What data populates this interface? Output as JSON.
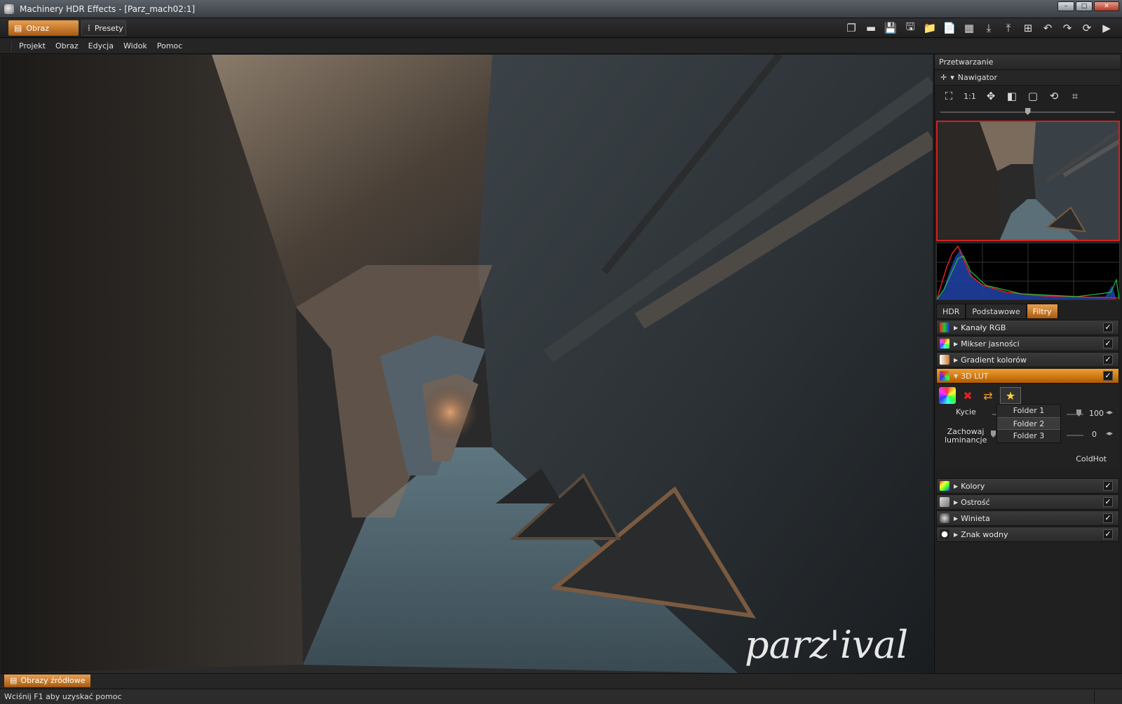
{
  "window": {
    "title": "Machinery HDR Effects - [Parz_mach02:1]",
    "controls": [
      "–",
      "□",
      "✕"
    ]
  },
  "toolbar": {
    "tabs": [
      {
        "label": "Obraz",
        "icon": "image-stack-icon"
      },
      {
        "label": "Presety",
        "icon": "grid-icon"
      }
    ],
    "tools": [
      {
        "name": "window-icon",
        "glyph": "❐"
      },
      {
        "name": "landscape-icon",
        "glyph": "▬"
      },
      {
        "name": "save-icon",
        "glyph": "💾"
      },
      {
        "name": "save-as-icon",
        "glyph": "🖫"
      },
      {
        "name": "folder-icon",
        "glyph": "📁"
      },
      {
        "name": "new-file-icon",
        "glyph": "📄"
      },
      {
        "name": "pattern-icon",
        "glyph": "▦"
      },
      {
        "name": "download-icon",
        "glyph": "⤓"
      },
      {
        "name": "upload-icon",
        "glyph": "⤒"
      },
      {
        "name": "add-layer-icon",
        "glyph": "⊞"
      },
      {
        "name": "undo-icon",
        "glyph": "↶"
      },
      {
        "name": "redo-icon",
        "glyph": "↷"
      },
      {
        "name": "process-icon",
        "glyph": "⟳"
      },
      {
        "name": "play-icon",
        "glyph": "▶"
      }
    ]
  },
  "menu": [
    "Projekt",
    "Obraz",
    "Edycja",
    "Widok",
    "Pomoc"
  ],
  "image": {
    "watermark": "parz'ival"
  },
  "panel": {
    "header": "Przetwarzanie",
    "navigator": {
      "label": "Nawigator",
      "tools": [
        {
          "name": "fit-icon",
          "glyph": "⛶"
        },
        {
          "name": "actual-size-icon",
          "glyph": "1:1"
        },
        {
          "name": "pan-icon",
          "glyph": "✥"
        },
        {
          "name": "compare-icon",
          "glyph": "◧"
        },
        {
          "name": "frame-icon",
          "glyph": "▢"
        },
        {
          "name": "rotate-icon",
          "glyph": "⟲"
        },
        {
          "name": "crop-icon",
          "glyph": "⌗"
        }
      ],
      "zoom_level": 0.5
    },
    "subtabs": [
      {
        "label": "HDR",
        "active": false
      },
      {
        "label": "Podstawowe",
        "active": false
      },
      {
        "label": "Filtry",
        "active": true
      }
    ],
    "filters_top": [
      {
        "label": "Kanały RGB",
        "icon": "rgb-channels-icon",
        "checked": true
      },
      {
        "label": "Mikser jasności",
        "icon": "luminance-mixer-icon",
        "checked": true
      },
      {
        "label": "Gradient kolorów",
        "icon": "color-gradient-icon",
        "checked": true
      },
      {
        "label": "3D LUT",
        "icon": "lut-cube-icon",
        "checked": true,
        "expanded": true
      }
    ],
    "lut": {
      "opacity_label": "Kycie",
      "opacity_value": "100",
      "preserve_label_line1": "Zachowaj",
      "preserve_label_line2": "luminancje",
      "preserve_value": "0",
      "folders": [
        "Folder 1",
        "Folder 2",
        "Folder 3"
      ],
      "selected_folder": 1,
      "lut_name": "ColdHot"
    },
    "filters_bottom": [
      {
        "label": "Kolory",
        "icon": "colors-icon",
        "checked": true
      },
      {
        "label": "Ostrość",
        "icon": "sharpness-icon",
        "checked": true
      },
      {
        "label": "Winieta",
        "icon": "vignette-icon",
        "checked": true
      },
      {
        "label": "Znak wodny",
        "icon": "watermark-icon",
        "checked": true
      }
    ]
  },
  "bottom_tab": "Obrazy źródłowe",
  "status": "Wciśnij F1 aby uzyskać pomoc",
  "colors": {
    "accent": "#e8a050",
    "accent_dark": "#a85a12",
    "preview_border": "#d12222"
  }
}
